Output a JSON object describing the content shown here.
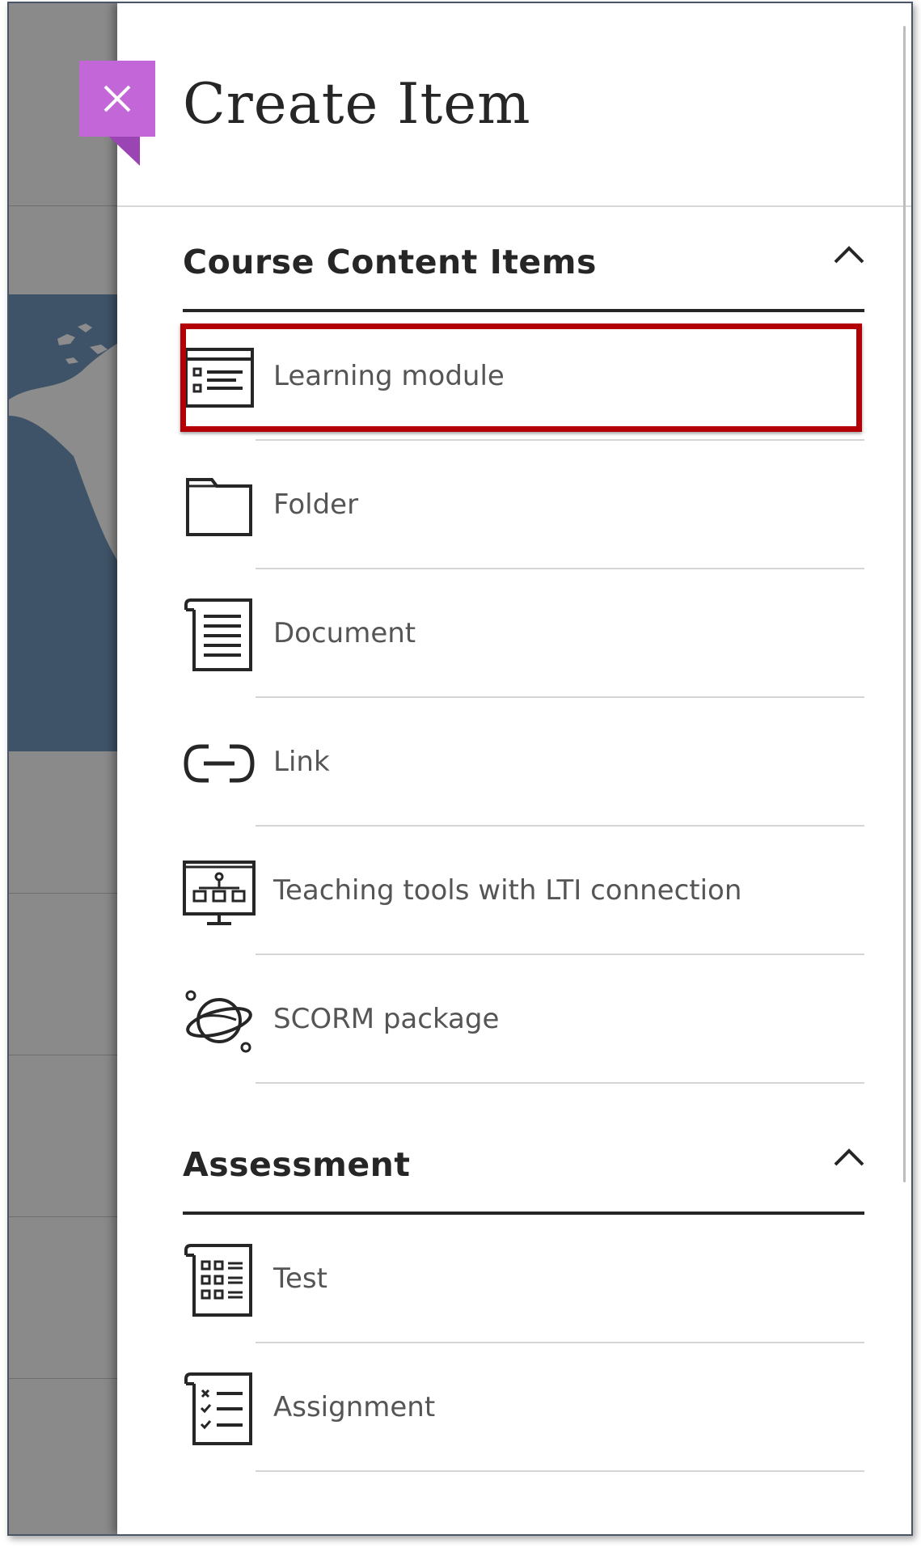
{
  "panel": {
    "title": "Create Item"
  },
  "sections": [
    {
      "title": "Course Content Items",
      "expanded": true,
      "items": [
        {
          "label": "Learning module",
          "icon": "learning-module-icon"
        },
        {
          "label": "Folder",
          "icon": "folder-icon"
        },
        {
          "label": "Document",
          "icon": "document-icon"
        },
        {
          "label": "Link",
          "icon": "link-icon"
        },
        {
          "label": "Teaching tools with LTI connection",
          "icon": "lti-tools-icon"
        },
        {
          "label": "SCORM package",
          "icon": "scorm-package-icon"
        }
      ]
    },
    {
      "title": "Assessment",
      "expanded": true,
      "items": [
        {
          "label": "Test",
          "icon": "test-icon"
        },
        {
          "label": "Assignment",
          "icon": "assignment-icon"
        }
      ]
    }
  ],
  "colors": {
    "close_button": "#c266d8",
    "highlight": "#b30006",
    "text_dark": "#262626",
    "text_item": "#555555"
  }
}
